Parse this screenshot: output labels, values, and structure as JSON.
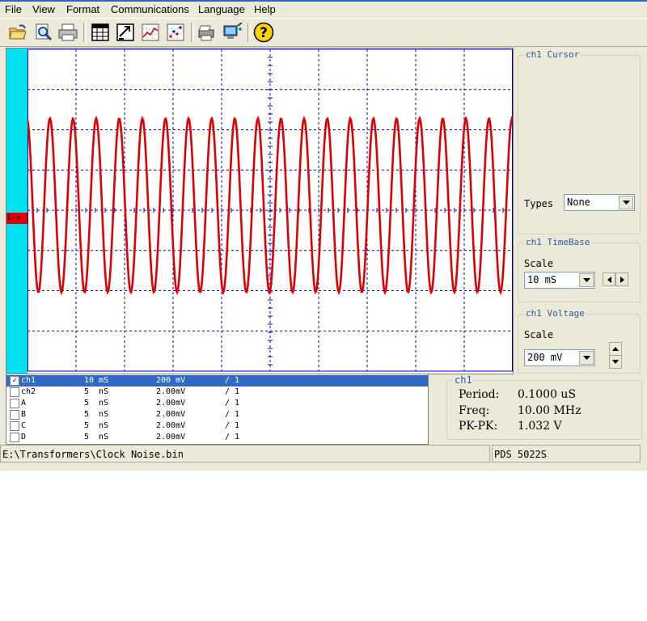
{
  "menu": [
    "File",
    "View",
    "Format",
    "Communications",
    "Language",
    "Help"
  ],
  "toolbar": {
    "icons": [
      "open-folder-icon",
      "print-preview-icon",
      "print-icon",
      "table-icon",
      "export-icon",
      "chart-icon",
      "scatter-icon",
      "printer-setup-icon",
      "connect-icon",
      "help-icon"
    ],
    "help_glyph": "?"
  },
  "scope": {
    "channel_marker": "1->",
    "trace_color": "#e00000",
    "grid_color": "#0000cc",
    "strip_color": "#00e0ee",
    "cycles": 21,
    "amplitude_fraction": 0.5
  },
  "cursor": {
    "legend": "ch1 Cursor",
    "types_label": "Types",
    "types_value": "None"
  },
  "timebase": {
    "legend": "ch1 TimeBase",
    "scale_label": "Scale",
    "scale_value": "10 mS"
  },
  "voltage": {
    "legend": "ch1 Voltage",
    "scale_label": "Scale",
    "scale_value": "200 mV"
  },
  "channels": [
    {
      "name": "ch1",
      "checked": true,
      "time": "10 mS",
      "volt": "200 mV",
      "probe": "/ 1"
    },
    {
      "name": "ch2",
      "checked": false,
      "time": "5  nS",
      "volt": "2.00mV",
      "probe": "/ 1"
    },
    {
      "name": "A",
      "checked": false,
      "time": "5  nS",
      "volt": "2.00mV",
      "probe": "/ 1"
    },
    {
      "name": "B",
      "checked": false,
      "time": "5  nS",
      "volt": "2.00mV",
      "probe": "/ 1"
    },
    {
      "name": "C",
      "checked": false,
      "time": "5  nS",
      "volt": "2.00mV",
      "probe": "/ 1"
    },
    {
      "name": "D",
      "checked": false,
      "time": "5  nS",
      "volt": "2.00mV",
      "probe": "/ 1"
    }
  ],
  "measurements": {
    "legend": "ch1",
    "period_label": "Period:",
    "period_value": "0.1000 uS",
    "freq_label": "Freq:",
    "freq_value": "10.00 MHz",
    "pkpk_label": "PK-PK:",
    "pkpk_value": "1.032 V"
  },
  "status": {
    "file_path": "E:\\Transformers\\Clock Noise.bin",
    "device": "PDS 5022S"
  }
}
